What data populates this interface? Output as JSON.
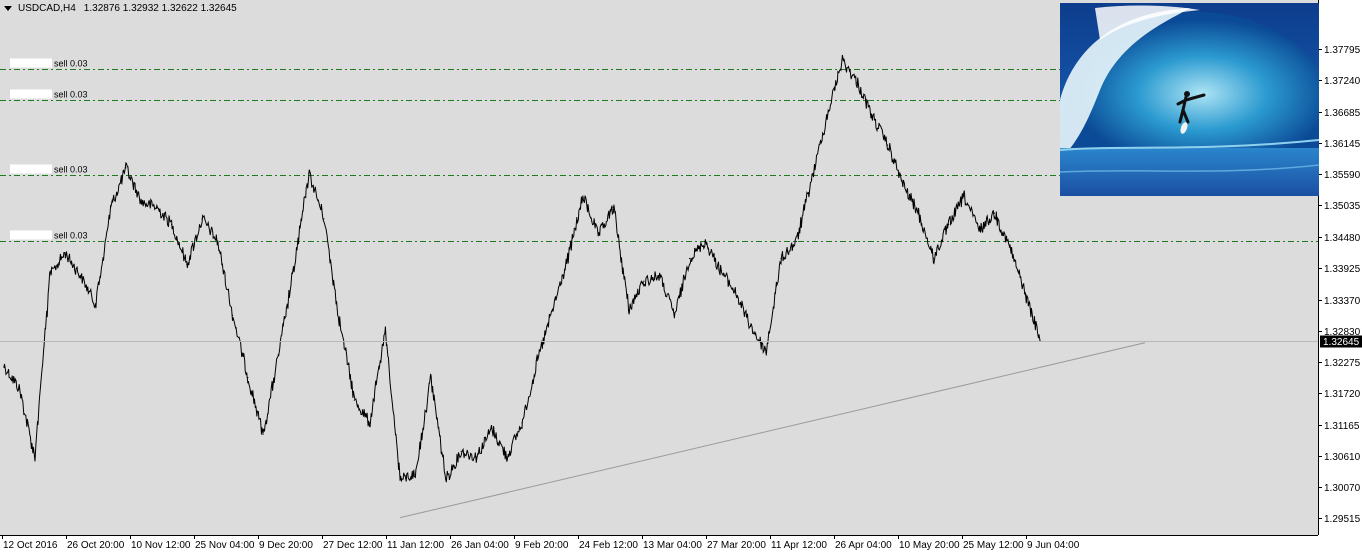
{
  "header": {
    "symbol": "USDCAD,H4",
    "ohlc": "1.32876 1.32932 1.32622 1.32645"
  },
  "colors": {
    "background": "#dcdcdc",
    "price_line": "#000000",
    "level_line": "#1f7a1f",
    "trend_line": "#9a9a9a",
    "current_tag_bg": "#000000",
    "current_tag_fg": "#ffffff"
  },
  "icons": {
    "dropdown": "triangle-down-icon",
    "picture": "surfer-wave-image"
  },
  "chart_data": {
    "type": "line",
    "title": "",
    "xlabel": "",
    "ylabel": "",
    "ylim": [
      1.294,
      1.382
    ],
    "grid": false,
    "yticks": [
      "1.37795",
      "1.37240",
      "1.36685",
      "1.36145",
      "1.35590",
      "1.35035",
      "1.34480",
      "1.33925",
      "1.33370",
      "1.32830",
      "1.32275",
      "1.31720",
      "1.31165",
      "1.30610",
      "1.30070",
      "1.29515"
    ],
    "xticks": [
      "12 Oct 2016",
      "26 Oct 20:00",
      "10 Nov 12:00",
      "25 Nov 04:00",
      "9 Dec 20:00",
      "27 Dec 12:00",
      "11 Jan 12:00",
      "26 Jan 04:00",
      "9 Feb 20:00",
      "24 Feb 12:00",
      "13 Mar 04:00",
      "27 Mar 20:00",
      "11 Apr 12:00",
      "26 Apr 04:00",
      "10 May 20:00",
      "25 May 12:00",
      "9 Jun 04:00"
    ],
    "current_price": "1.32645",
    "levels": [
      {
        "label": "sell 0.03",
        "value": 1.3745
      },
      {
        "label": "sell 0.03",
        "value": 1.369
      },
      {
        "label": "sell 0.03",
        "value": 1.3557
      },
      {
        "label": "sell 0.03",
        "value": 1.344
      }
    ],
    "trendline": {
      "from": {
        "x": 26,
        "y": 1.2953
      },
      "to": {
        "x": 72,
        "y": 1.3265
      }
    },
    "series": [
      {
        "points": [
          [
            0,
            1.322
          ],
          [
            1,
            1.318
          ],
          [
            2,
            1.306
          ],
          [
            3,
            1.338
          ],
          [
            4,
            1.342
          ],
          [
            5,
            1.338
          ],
          [
            6,
            1.333
          ],
          [
            7,
            1.35
          ],
          [
            8,
            1.357
          ],
          [
            9,
            1.351
          ],
          [
            10,
            1.35
          ],
          [
            11,
            1.347
          ],
          [
            12,
            1.34
          ],
          [
            13,
            1.348
          ],
          [
            14,
            1.344
          ],
          [
            15,
            1.331
          ],
          [
            16,
            1.32
          ],
          [
            17,
            1.31
          ],
          [
            18,
            1.324
          ],
          [
            19,
            1.339
          ],
          [
            20,
            1.356
          ],
          [
            21,
            1.348
          ],
          [
            22,
            1.33
          ],
          [
            23,
            1.316
          ],
          [
            24,
            1.312
          ],
          [
            25,
            1.328
          ],
          [
            26,
            1.302
          ],
          [
            27,
            1.303
          ],
          [
            28,
            1.32
          ],
          [
            29,
            1.302
          ],
          [
            30,
            1.307
          ],
          [
            31,
            1.306
          ],
          [
            32,
            1.311
          ],
          [
            33,
            1.306
          ],
          [
            34,
            1.312
          ],
          [
            35,
            1.323
          ],
          [
            36,
            1.332
          ],
          [
            37,
            1.341
          ],
          [
            38,
            1.352
          ],
          [
            39,
            1.345
          ],
          [
            40,
            1.35
          ],
          [
            41,
            1.332
          ],
          [
            42,
            1.337
          ],
          [
            43,
            1.338
          ],
          [
            44,
            1.331
          ],
          [
            45,
            1.341
          ],
          [
            46,
            1.344
          ],
          [
            47,
            1.339
          ],
          [
            48,
            1.335
          ],
          [
            49,
            1.329
          ],
          [
            50,
            1.3245
          ],
          [
            51,
            1.341
          ],
          [
            52,
            1.344
          ],
          [
            53,
            1.355
          ],
          [
            54,
            1.366
          ],
          [
            55,
            1.376
          ],
          [
            56,
            1.372
          ],
          [
            57,
            1.366
          ],
          [
            58,
            1.361
          ],
          [
            59,
            1.354
          ],
          [
            60,
            1.349
          ],
          [
            61,
            1.341
          ],
          [
            62,
            1.347
          ],
          [
            63,
            1.352
          ],
          [
            64,
            1.346
          ],
          [
            65,
            1.349
          ],
          [
            66,
            1.343
          ],
          [
            67,
            1.335
          ],
          [
            68,
            1.3265
          ]
        ]
      }
    ]
  }
}
